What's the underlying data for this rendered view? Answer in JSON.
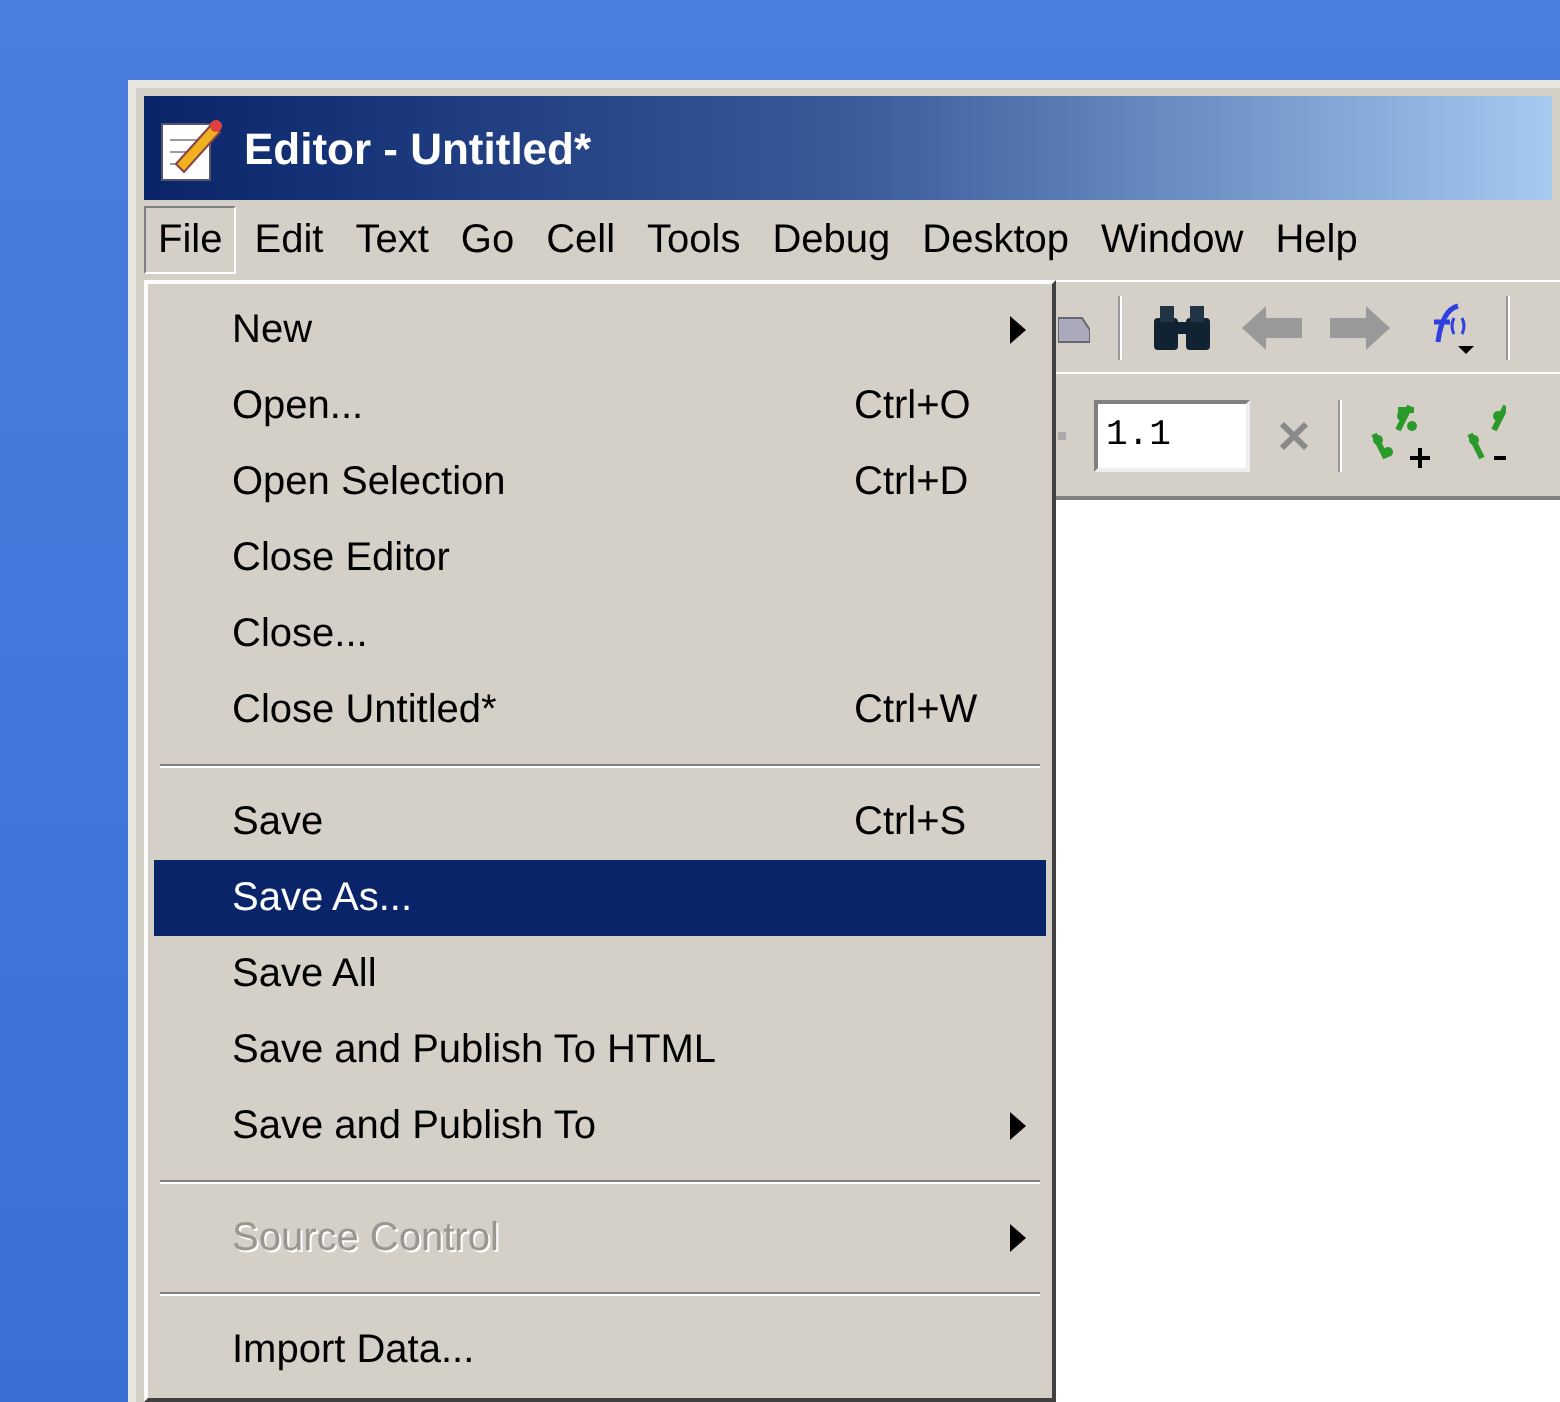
{
  "window": {
    "title": "Editor - Untitled*"
  },
  "menubar": [
    {
      "label": "File",
      "selected": true
    },
    {
      "label": "Edit",
      "selected": false
    },
    {
      "label": "Text",
      "selected": false
    },
    {
      "label": "Go",
      "selected": false
    },
    {
      "label": "Cell",
      "selected": false
    },
    {
      "label": "Tools",
      "selected": false
    },
    {
      "label": "Debug",
      "selected": false
    },
    {
      "label": "Desktop",
      "selected": false
    },
    {
      "label": "Window",
      "selected": false
    },
    {
      "label": "Help",
      "selected": false
    }
  ],
  "toolbar": {
    "field_value": "1.1"
  },
  "file_menu": [
    {
      "kind": "item",
      "label": "New",
      "submenu": true,
      "disabled": false,
      "selected": false
    },
    {
      "kind": "item",
      "label": "Open...",
      "shortcut": "Ctrl+O",
      "disabled": false,
      "selected": false
    },
    {
      "kind": "item",
      "label": "Open Selection",
      "shortcut": "Ctrl+D",
      "disabled": false,
      "selected": false
    },
    {
      "kind": "item",
      "label": "Close Editor",
      "disabled": false,
      "selected": false
    },
    {
      "kind": "item",
      "label": "Close...",
      "disabled": false,
      "selected": false
    },
    {
      "kind": "item",
      "label": "Close Untitled*",
      "shortcut": "Ctrl+W",
      "disabled": false,
      "selected": false
    },
    {
      "kind": "separator"
    },
    {
      "kind": "item",
      "label": "Save",
      "shortcut": "Ctrl+S",
      "disabled": false,
      "selected": false
    },
    {
      "kind": "item",
      "label": "Save As...",
      "disabled": false,
      "selected": true
    },
    {
      "kind": "item",
      "label": "Save All",
      "disabled": false,
      "selected": false
    },
    {
      "kind": "item",
      "label": "Save and Publish To HTML",
      "disabled": false,
      "selected": false
    },
    {
      "kind": "item",
      "label": "Save and Publish To",
      "submenu": true,
      "disabled": false,
      "selected": false
    },
    {
      "kind": "separator"
    },
    {
      "kind": "item",
      "label": "Source Control",
      "submenu": true,
      "disabled": true,
      "selected": false
    },
    {
      "kind": "separator"
    },
    {
      "kind": "item",
      "label": "Import Data...",
      "disabled": false,
      "selected": false
    }
  ]
}
